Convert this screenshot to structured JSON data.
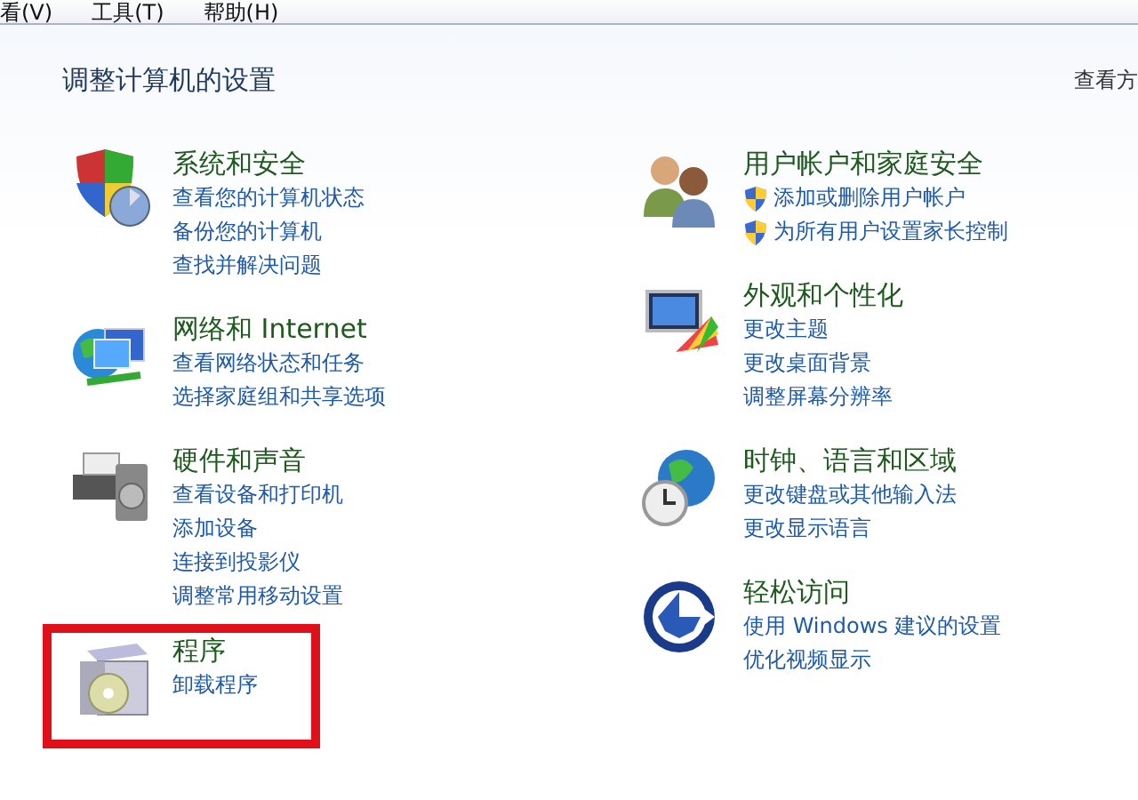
{
  "menu_bar": [
    "看(V)",
    "工具(T)",
    "帮助(H)"
  ],
  "heading": "调整计算机的设置",
  "view_by": "查看方",
  "columns": [
    {
      "categories": [
        {
          "title": "系统和安全",
          "highlighted": false,
          "links": [
            {
              "text": "查看您的计算机状态",
              "shield": false
            },
            {
              "text": "备份您的计算机",
              "shield": false
            },
            {
              "text": "查找并解决问题",
              "shield": false
            }
          ]
        },
        {
          "title": "网络和 Internet",
          "highlighted": false,
          "links": [
            {
              "text": "查看网络状态和任务",
              "shield": false
            },
            {
              "text": "选择家庭组和共享选项",
              "shield": false
            }
          ]
        },
        {
          "title": "硬件和声音",
          "highlighted": false,
          "links": [
            {
              "text": "查看设备和打印机",
              "shield": false
            },
            {
              "text": "添加设备",
              "shield": false
            },
            {
              "text": "连接到投影仪",
              "shield": false
            },
            {
              "text": "调整常用移动设置",
              "shield": false
            }
          ]
        },
        {
          "title": "程序",
          "highlighted": true,
          "links": [
            {
              "text": "卸载程序",
              "shield": false
            }
          ]
        }
      ]
    },
    {
      "categories": [
        {
          "title": "用户帐户和家庭安全",
          "highlighted": false,
          "links": [
            {
              "text": "添加或删除用户帐户",
              "shield": true
            },
            {
              "text": "为所有用户设置家长控制",
              "shield": true
            }
          ]
        },
        {
          "title": "外观和个性化",
          "highlighted": false,
          "links": [
            {
              "text": "更改主题",
              "shield": false
            },
            {
              "text": "更改桌面背景",
              "shield": false
            },
            {
              "text": "调整屏幕分辨率",
              "shield": false
            }
          ]
        },
        {
          "title": "时钟、语言和区域",
          "highlighted": false,
          "links": [
            {
              "text": "更改键盘或其他输入法",
              "shield": false
            },
            {
              "text": "更改显示语言",
              "shield": false
            }
          ]
        },
        {
          "title": "轻松访问",
          "highlighted": false,
          "links": [
            {
              "text": "使用 Windows 建议的设置",
              "shield": false
            },
            {
              "text": "优化视频显示",
              "shield": false
            }
          ]
        }
      ]
    }
  ]
}
